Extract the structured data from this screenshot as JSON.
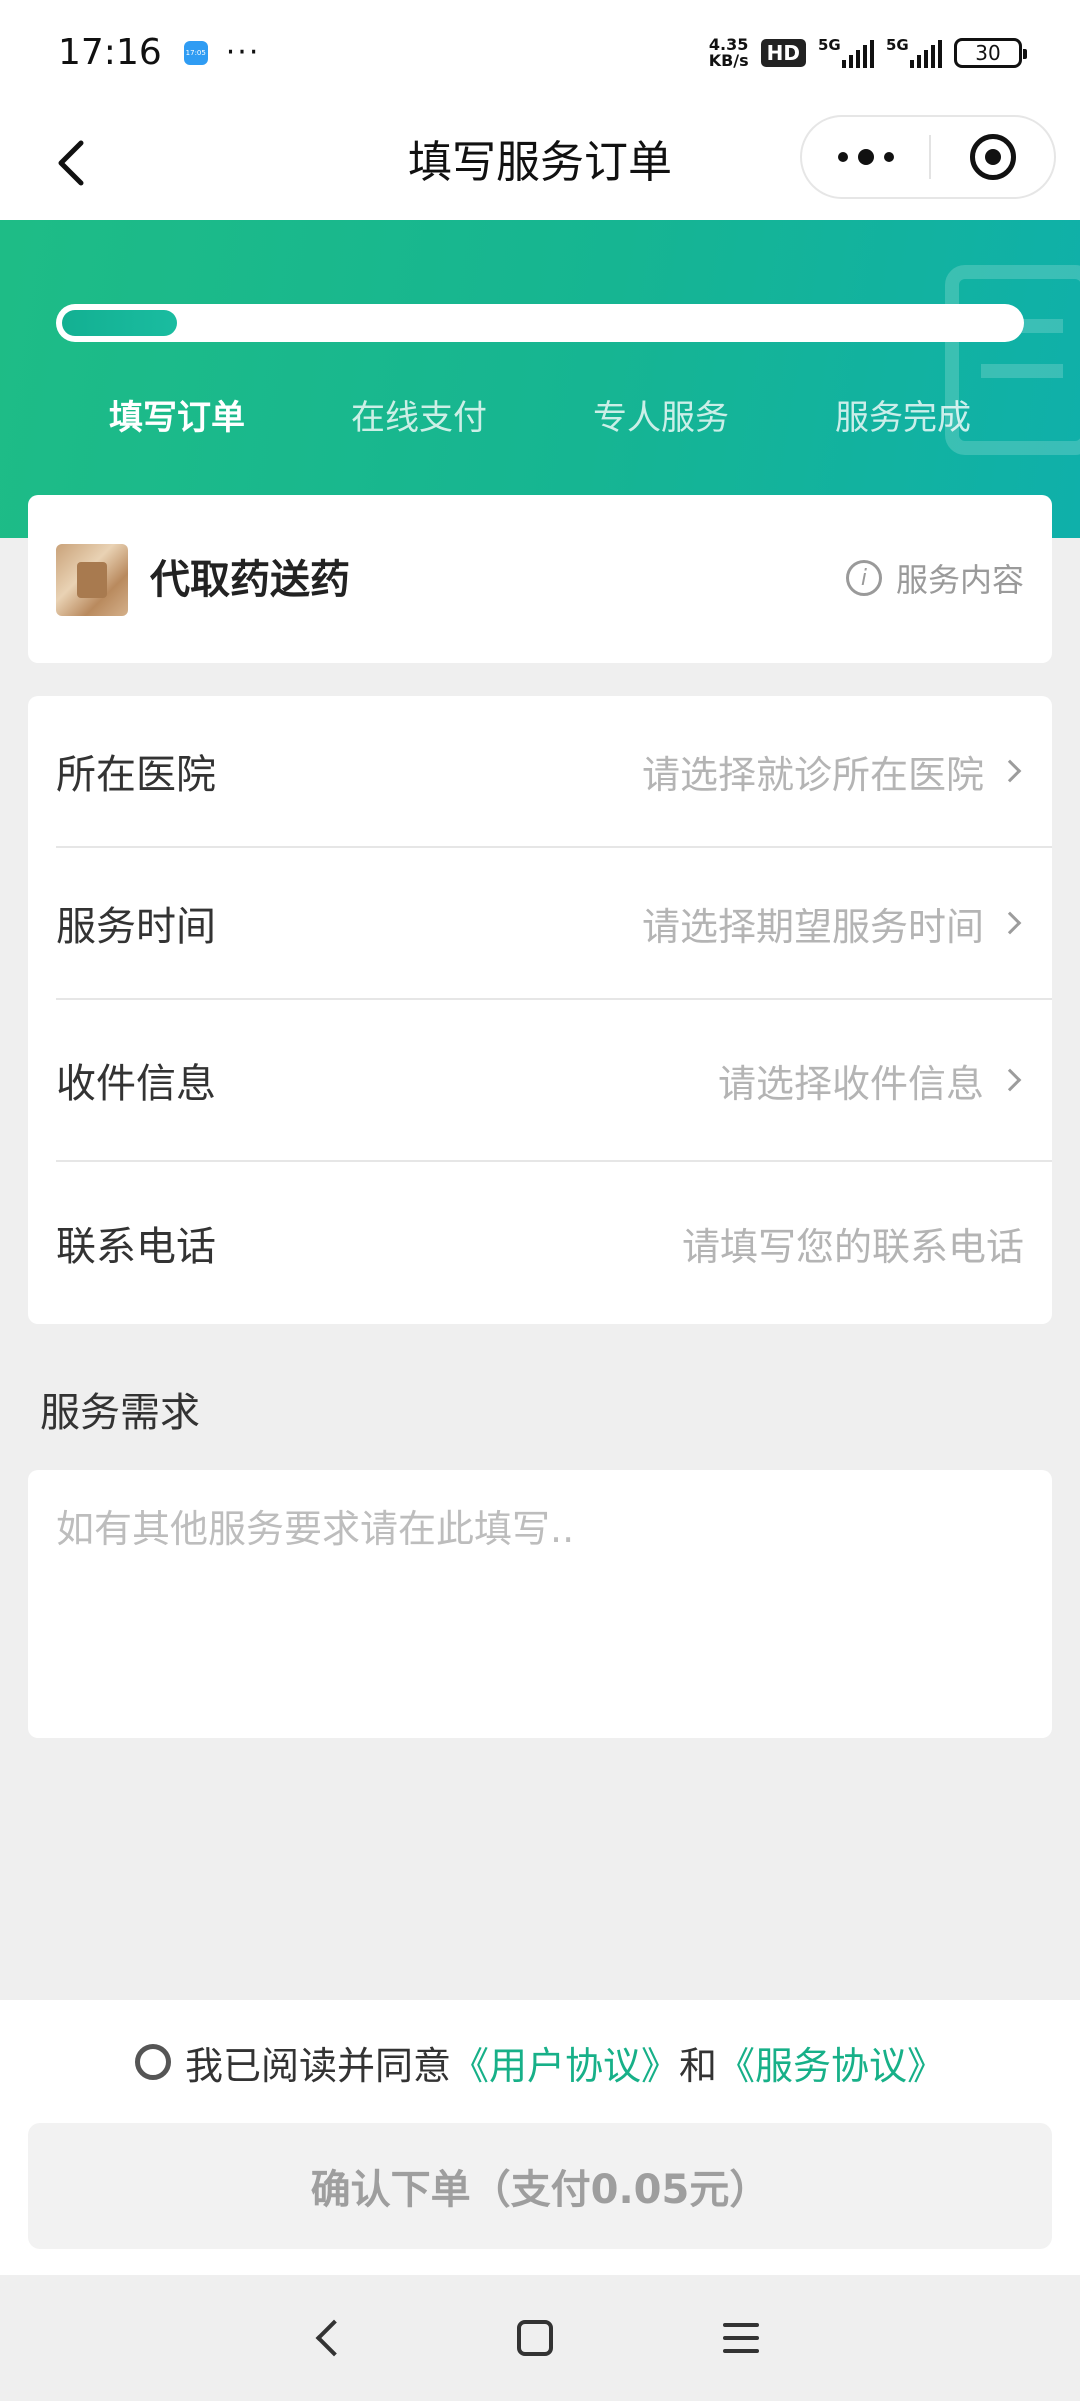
{
  "status_bar": {
    "time": "17:16",
    "mini_icon_text": "17:05",
    "more": "···",
    "net_speed_value": "4.35",
    "net_speed_unit": "KB/s",
    "hd": "HD",
    "signal_1": "5G",
    "signal_2": "5G",
    "battery": "30"
  },
  "nav": {
    "title": "填写服务订单"
  },
  "progress": {
    "fraction": 0.12,
    "steps": [
      "填写订单",
      "在线支付",
      "专人服务",
      "服务完成"
    ],
    "active_step": 0
  },
  "service": {
    "name": "代取药送药",
    "info_label": "服务内容",
    "info_glyph": "i"
  },
  "form": {
    "rows": [
      {
        "label": "所在医院",
        "placeholder": "请选择就诊所在医院",
        "chevron": true
      },
      {
        "label": "服务时间",
        "placeholder": "请选择期望服务时间",
        "chevron": true
      },
      {
        "label": "收件信息",
        "placeholder": "请选择收件信息",
        "chevron": true
      },
      {
        "label": "联系电话",
        "placeholder": "请填写您的联系电话",
        "chevron": false
      }
    ]
  },
  "requirements": {
    "title": "服务需求",
    "placeholder": "如有其他服务要求请在此填写.."
  },
  "agreement": {
    "prefix": "我已阅读并同意",
    "user_agreement": "《用户协议》",
    "and": "和",
    "service_agreement": "《服务协议》"
  },
  "confirm_button": "确认下单（支付0.05元）",
  "colors": {
    "brand_green": "#17b088",
    "header_gradient_start": "#1ebc86",
    "header_gradient_end": "#0fb0aa",
    "placeholder_gray": "#b4b4b4",
    "disabled_button_bg": "#f2f2f2"
  }
}
